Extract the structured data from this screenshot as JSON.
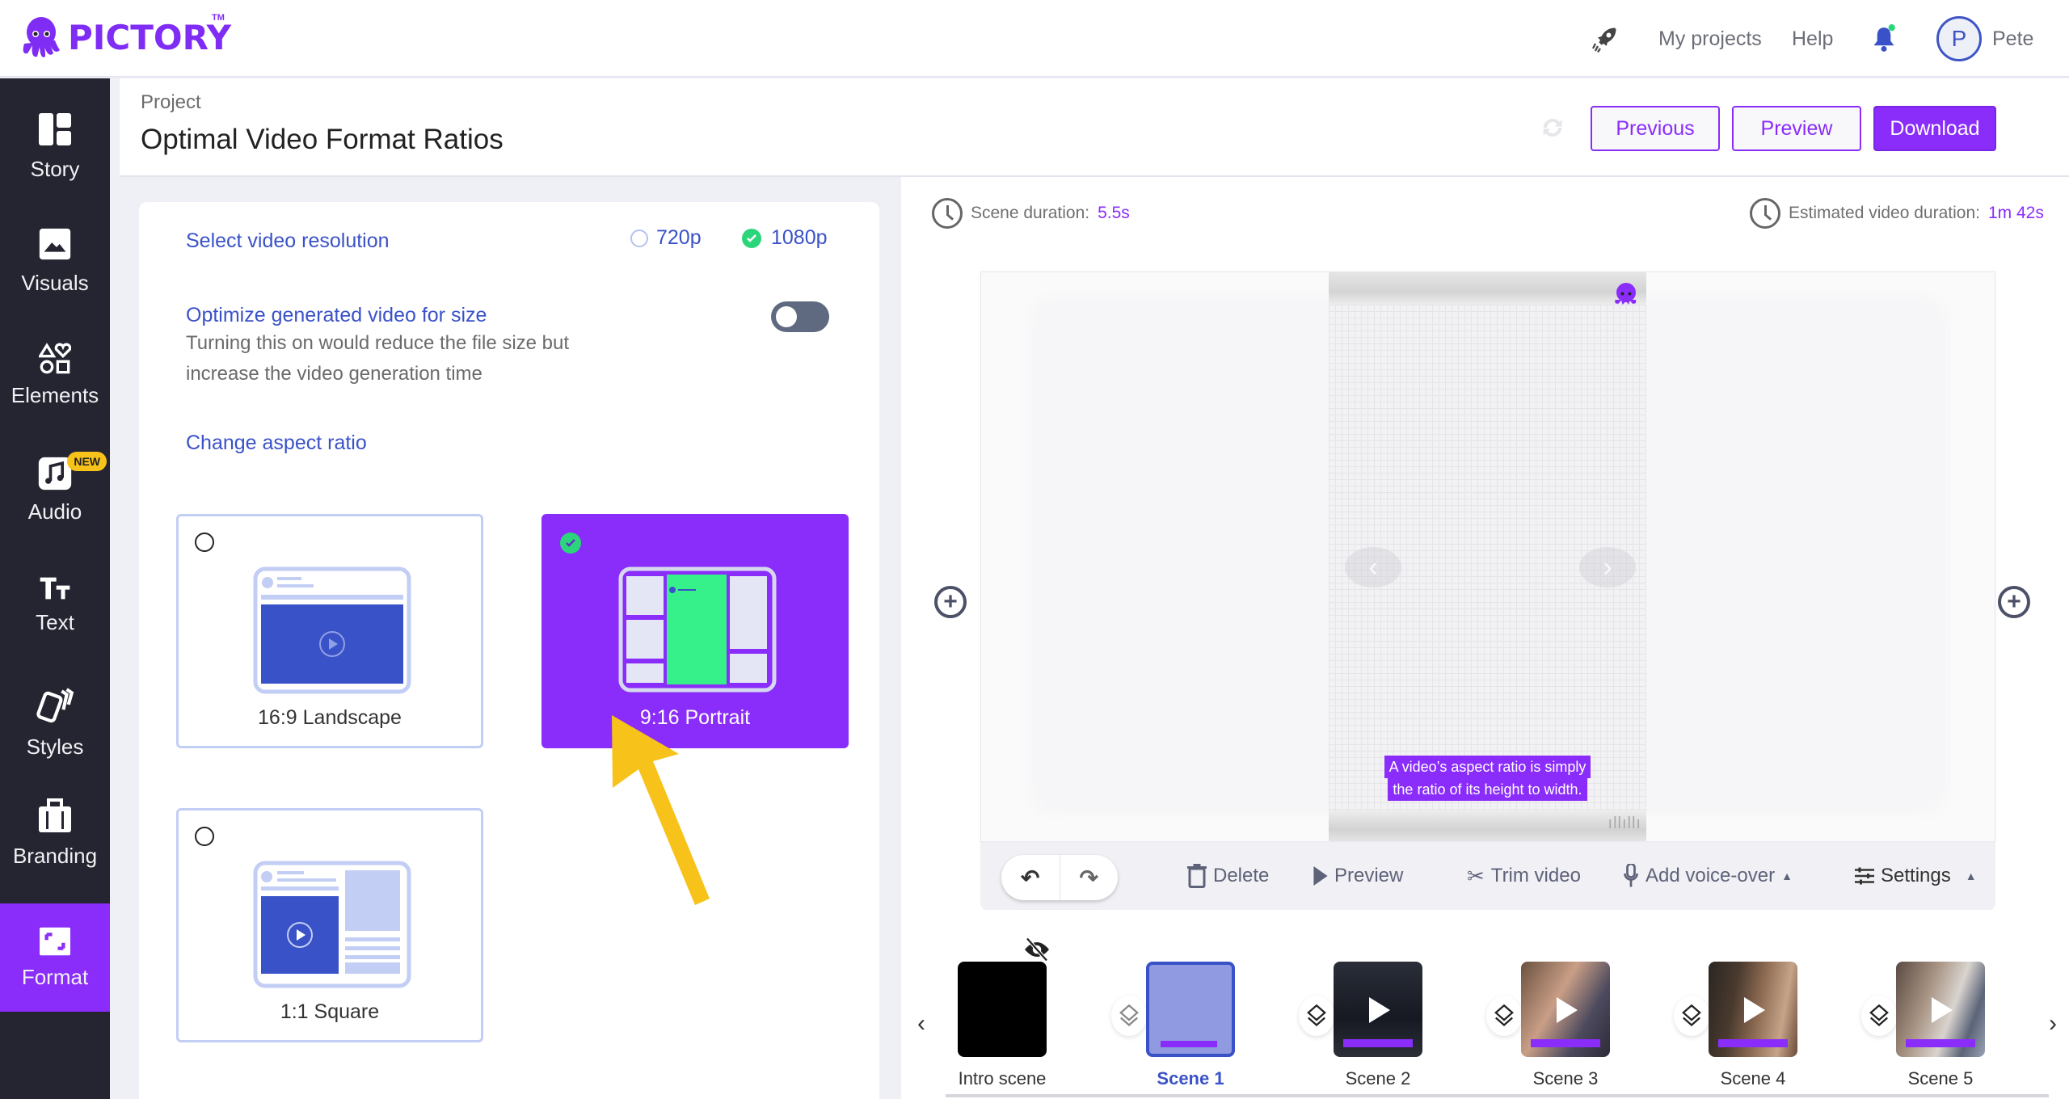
{
  "app": {
    "brand": "PICTORY",
    "trademark": "TM",
    "colors": {
      "accent": "#8a2cfa",
      "link": "#3a52c8",
      "success": "#2bd67b",
      "sidebar": "#252532",
      "annotation_arrow": "#f7c21a"
    }
  },
  "topbar": {
    "rocket_icon": "rocket-icon",
    "my_projects": "My projects",
    "help": "Help",
    "bell_icon": "bell-icon",
    "avatar_initial": "P",
    "user_name": "Pete"
  },
  "sidebar": {
    "items": [
      {
        "label": "Story",
        "icon": "layout-icon",
        "active": false
      },
      {
        "label": "Visuals",
        "icon": "image-icon",
        "active": false
      },
      {
        "label": "Elements",
        "icon": "shapes-icon",
        "active": false
      },
      {
        "label": "Audio",
        "icon": "music-icon",
        "active": false,
        "badge": "NEW"
      },
      {
        "label": "Text",
        "icon": "text-icon",
        "active": false
      },
      {
        "label": "Styles",
        "icon": "styles-icon",
        "active": false
      },
      {
        "label": "Branding",
        "icon": "briefcase-icon",
        "active": false
      },
      {
        "label": "Format",
        "icon": "format-icon",
        "active": true
      }
    ]
  },
  "project": {
    "label": "Project",
    "title": "Optimal Video Format Ratios",
    "buttons": {
      "previous": "Previous",
      "preview": "Preview",
      "download": "Download"
    }
  },
  "format_panel": {
    "resolution_label": "Select video resolution",
    "resolution_options": [
      {
        "label": "720p",
        "selected": false
      },
      {
        "label": "1080p",
        "selected": true
      }
    ],
    "optimize_label": "Optimize generated video for size",
    "optimize_desc_line1": "Turning this on would reduce the file size but",
    "optimize_desc_line2": "increase the video generation time",
    "optimize_enabled": false,
    "aspect_label": "Change aspect ratio",
    "aspect_options": [
      {
        "label": "16:9 Landscape",
        "selected": false
      },
      {
        "label": "9:16 Portrait",
        "selected": true
      },
      {
        "label": "1:1 Square",
        "selected": false
      }
    ]
  },
  "editor": {
    "scene_duration_label": "Scene duration:",
    "scene_duration_value": "5.5s",
    "estimated_duration_label": "Estimated video duration:",
    "estimated_duration_value": "1m 42s",
    "caption_line1": "A video’s aspect ratio is simply",
    "caption_line2": "the ratio of its height to width.",
    "toolbar": {
      "delete": "Delete",
      "preview": "Preview",
      "trim": "Trim video",
      "voiceover": "Add voice-over",
      "settings": "Settings"
    }
  },
  "scenes": [
    {
      "label": "Intro scene",
      "active": false,
      "hidden": true
    },
    {
      "label": "Scene 1",
      "active": true
    },
    {
      "label": "Scene 2",
      "active": false
    },
    {
      "label": "Scene 3",
      "active": false
    },
    {
      "label": "Scene 4",
      "active": false
    },
    {
      "label": "Scene 5",
      "active": false
    }
  ]
}
